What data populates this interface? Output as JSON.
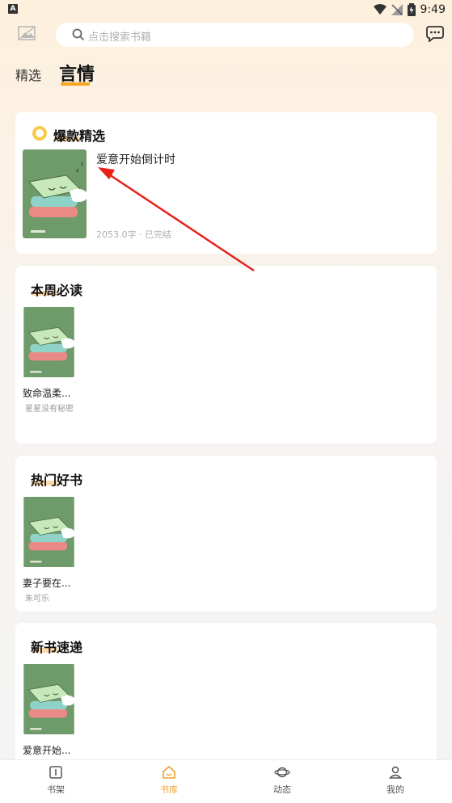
{
  "status": {
    "sim_glyph": "A",
    "time": "9:49"
  },
  "search": {
    "placeholder": "点击搜索书籍"
  },
  "tabs": [
    {
      "label": "精选",
      "active": false
    },
    {
      "label": "言情",
      "active": true
    }
  ],
  "hot_picks": {
    "title": "爆款精选",
    "book": {
      "name": "爱意开始倒计时",
      "meta": "2053.0字 · 已完结"
    }
  },
  "weekly": {
    "title": "本周必读",
    "book": {
      "name": "致命温柔...",
      "author": "星星没有秘密"
    }
  },
  "popular": {
    "title": "热门好书",
    "book": {
      "name": "妻子要在...",
      "author": "朱可乐"
    }
  },
  "new_books": {
    "title": "新书速递",
    "book": {
      "name": "爱意开始..."
    }
  },
  "nav": [
    {
      "label": "书架",
      "icon": "bookshelf-icon",
      "active": false
    },
    {
      "label": "书库",
      "icon": "library-icon",
      "active": true
    },
    {
      "label": "动态",
      "icon": "planet-icon",
      "active": false
    },
    {
      "label": "我的",
      "icon": "profile-icon",
      "active": false
    }
  ],
  "colors": {
    "accent": "#f0a030",
    "annotation_arrow": "#e8201a",
    "cover_bg": "#6f9a6a"
  }
}
